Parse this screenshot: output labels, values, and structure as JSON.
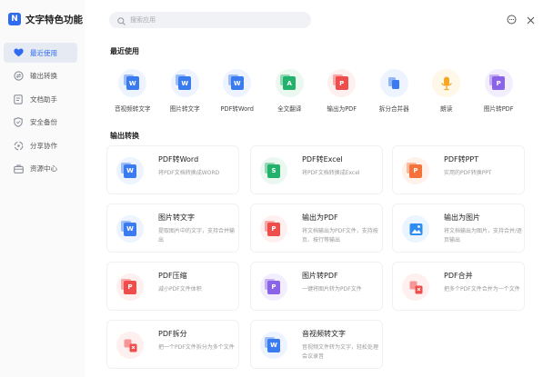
{
  "app": {
    "title": "文字特色功能",
    "logo_text": "N"
  },
  "search": {
    "placeholder": "搜索应用",
    "value": ""
  },
  "sidebar": {
    "items": [
      {
        "label": "最近使用",
        "icon": "heart-icon",
        "active": true
      },
      {
        "label": "输出转换",
        "icon": "convert-icon",
        "active": false
      },
      {
        "label": "文档助手",
        "icon": "document-assistant-icon",
        "active": false
      },
      {
        "label": "安全备份",
        "icon": "shield-icon",
        "active": false
      },
      {
        "label": "分享协作",
        "icon": "share-icon",
        "active": false
      },
      {
        "label": "资源中心",
        "icon": "briefcase-icon",
        "active": false
      }
    ]
  },
  "recent": {
    "title": "最近使用",
    "items": [
      {
        "label": "音视频转文字",
        "icon": "video-to-text-icon",
        "color": "#3a7bf0",
        "bg": "#eef4ff",
        "glyph": "W"
      },
      {
        "label": "图片转文字",
        "icon": "image-to-text-icon",
        "color": "#3a7bf0",
        "bg": "#eef4ff",
        "glyph": "W"
      },
      {
        "label": "PDF转Word",
        "icon": "pdf-to-word-icon",
        "color": "#3a7bf0",
        "bg": "#eef4ff",
        "glyph": "W"
      },
      {
        "label": "全文翻译",
        "icon": "translate-icon",
        "color": "#23b26c",
        "bg": "#eaf8f0",
        "glyph": "A"
      },
      {
        "label": "输出为PDF",
        "icon": "export-pdf-icon",
        "color": "#ef4c4c",
        "bg": "#fff0f0",
        "glyph": "P"
      },
      {
        "label": "拆分合并器",
        "icon": "split-merge-icon",
        "color": "#3a7bf0",
        "bg": "#eef4ff",
        "glyph": ""
      },
      {
        "label": "朗读",
        "icon": "microphone-icon",
        "color": "#f5a623",
        "bg": "#fff7e8",
        "glyph": ""
      },
      {
        "label": "图片转PDF",
        "icon": "image-to-pdf-icon",
        "color": "#8b63e8",
        "bg": "#f3eefe",
        "glyph": "P"
      }
    ]
  },
  "convert": {
    "title": "输出转换",
    "cards": [
      {
        "title": "PDF转Word",
        "desc": "将PDF文档转换成WORD",
        "icon": "pdf-to-word-icon",
        "color": "#3a7bf0",
        "bg": "#eef4ff",
        "glyph": "W"
      },
      {
        "title": "PDF转Excel",
        "desc": "将PDF文档转换成Excel",
        "icon": "pdf-to-excel-icon",
        "color": "#23b26c",
        "bg": "#eaf8f0",
        "glyph": "S"
      },
      {
        "title": "PDF转PPT",
        "desc": "实用的PDF转换PPT",
        "icon": "pdf-to-ppt-icon",
        "color": "#f5733a",
        "bg": "#fff2ea",
        "glyph": "P"
      },
      {
        "title": "图片转文字",
        "desc": "提取图片中的文字，支持合并输出",
        "icon": "image-to-text-icon",
        "color": "#3a7bf0",
        "bg": "#eef4ff",
        "glyph": "W"
      },
      {
        "title": "输出为PDF",
        "desc": "将文档输出为PDF文件，支持按页、按行等输出",
        "icon": "export-pdf-icon",
        "color": "#ef4c4c",
        "bg": "#fff0f0",
        "glyph": "P"
      },
      {
        "title": "输出为图片",
        "desc": "将文档输出为图片，支持合并/逐页输出",
        "icon": "export-image-icon",
        "color": "#2f8df2",
        "bg": "#ebf5ff",
        "glyph": ""
      },
      {
        "title": "PDF压缩",
        "desc": "减小PDF文件体积",
        "icon": "pdf-compress-icon",
        "color": "#ef4c4c",
        "bg": "#fff0f0",
        "glyph": "P"
      },
      {
        "title": "图片转PDF",
        "desc": "一键将图片转为PDF文件",
        "icon": "image-to-pdf-icon",
        "color": "#8b63e8",
        "bg": "#f3eefe",
        "glyph": "P"
      },
      {
        "title": "PDF合并",
        "desc": "把多个PDF文件合并为一个文件",
        "icon": "pdf-merge-icon",
        "color": "#ef4c4c",
        "bg": "#fff0f0",
        "glyph": ""
      },
      {
        "title": "PDF拆分",
        "desc": "把一个PDF文件拆分为多个文件",
        "icon": "pdf-split-icon",
        "color": "#ef4c4c",
        "bg": "#fff0f0",
        "glyph": ""
      },
      {
        "title": "音视频转文字",
        "desc": "音视频文件转为文字，轻松处理会议录音",
        "icon": "video-to-text-icon",
        "color": "#3a7bf0",
        "bg": "#eef4ff",
        "glyph": "W"
      }
    ]
  },
  "colors": {
    "accent": "#2f6bf2",
    "sidebar_bg": "#fafafa",
    "active_bg": "#e6eaf2"
  }
}
